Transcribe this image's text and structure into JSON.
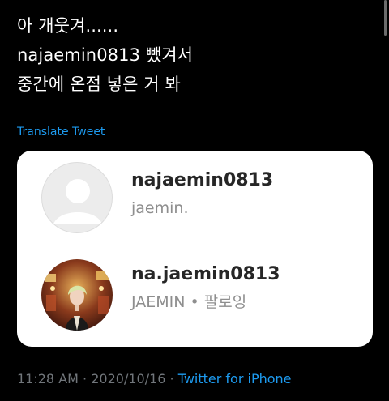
{
  "tweet": {
    "lines": [
      "아 개웃겨......",
      "najaemin0813 뺐겨서",
      "중간에 온점 넣은 거 봐"
    ],
    "translate_label": "Translate Tweet"
  },
  "card": {
    "accounts": [
      {
        "handle": "najaemin0813",
        "display_name": "jaemin.",
        "avatar": "default-avatar-icon"
      },
      {
        "handle": "na.jaemin0813",
        "display_name": "JAEMIN • 팔로잉",
        "avatar": "profile-photo"
      }
    ]
  },
  "meta": {
    "time": "11:28 AM",
    "separator": " · ",
    "date": "2020/10/16",
    "source": "Twitter for iPhone"
  },
  "colors": {
    "background": "#000000",
    "link": "#1d9bf0",
    "muted": "#71767b"
  }
}
